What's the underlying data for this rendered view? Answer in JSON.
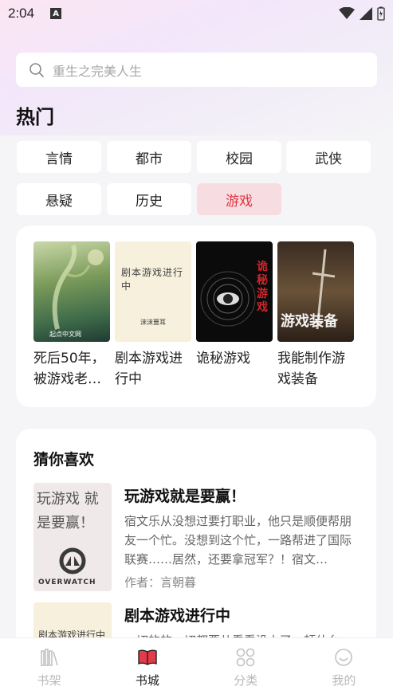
{
  "status": {
    "time": "2:04",
    "notif": "A"
  },
  "search": {
    "placeholder": "重生之完美人生"
  },
  "hot": {
    "title": "热门",
    "tags": [
      "言情",
      "都市",
      "校园",
      "武侠",
      "悬疑",
      "历史",
      "游戏"
    ],
    "active": "游戏"
  },
  "books": [
    {
      "title": "死后50年，被游戏老…",
      "cover_text": "起点中文网"
    },
    {
      "title": "剧本游戏进行中",
      "cover_text": "剧本游戏进行中",
      "cover_author": "沫沫噩耳"
    },
    {
      "title": "诡秘游戏",
      "cover_text": "诡秘游戏"
    },
    {
      "title": "我能制作游戏装备",
      "cover_text": "游戏装备"
    }
  ],
  "guess": {
    "title": "猜你喜欢",
    "items": [
      {
        "title": "玩游戏就是要赢！",
        "desc": "宿文乐从没想过要打职业，他只是顺便帮朋友一个忙。没想到这个忙，一路帮进了国际联赛……居然，还要拿冠军？！宿文…",
        "author": "作者：言朝暮",
        "cover_text": "玩游戏 就是要赢！",
        "cover_logo": "OVERWATCH"
      },
      {
        "title": "剧本游戏进行中",
        "desc": "一切的的一切都要从看看没上了一顿什么",
        "cover_text": "剧本游戏进行中"
      }
    ]
  },
  "tabs": [
    {
      "label": "书架",
      "icon": "bookshelf-icon"
    },
    {
      "label": "书城",
      "icon": "bookstore-icon"
    },
    {
      "label": "分类",
      "icon": "category-icon"
    },
    {
      "label": "我的",
      "icon": "profile-icon"
    }
  ],
  "active_tab": "书城",
  "colors": {
    "accent": "#e0343f",
    "active_tag_bg": "#f7dde1"
  }
}
